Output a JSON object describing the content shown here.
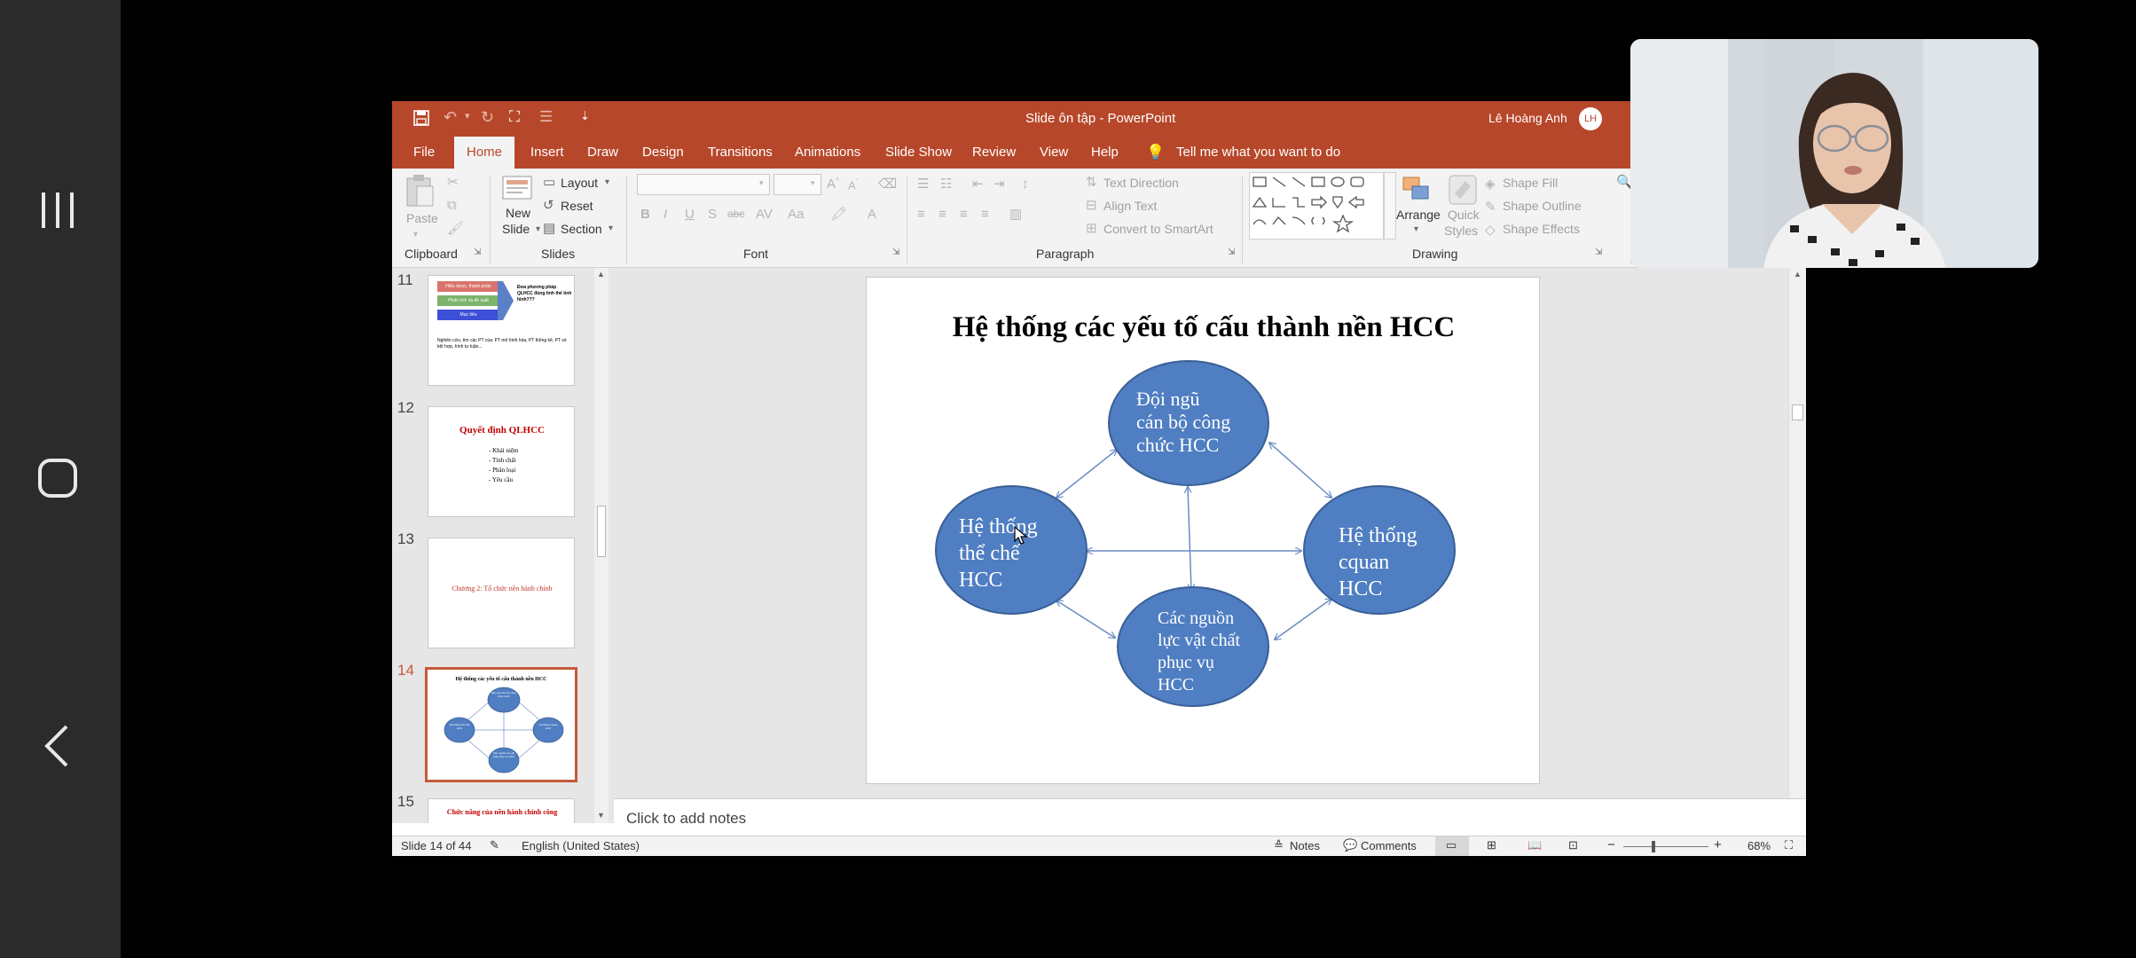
{
  "window": {
    "title": "Slide ôn tập - PowerPoint",
    "user_name": "Lê Hoàng Anh",
    "user_initials": "LH"
  },
  "tabs": [
    "File",
    "Home",
    "Insert",
    "Draw",
    "Design",
    "Transitions",
    "Animations",
    "Slide Show",
    "Review",
    "View",
    "Help"
  ],
  "tell_me": "Tell me what you want to do",
  "ribbon": {
    "clipboard": {
      "label": "Clipboard",
      "paste": "Paste"
    },
    "slides": {
      "label": "Slides",
      "new_slide_1": "New",
      "new_slide_2": "Slide",
      "layout": "Layout",
      "reset": "Reset",
      "section": "Section"
    },
    "font": {
      "label": "Font"
    },
    "paragraph": {
      "label": "Paragraph",
      "text_direction": "Text Direction",
      "align_text": "Align Text",
      "smartart": "Convert to SmartArt"
    },
    "drawing": {
      "label": "Drawing",
      "arrange": "Arrange",
      "quick_styles_1": "Quick",
      "quick_styles_2": "Styles",
      "shape_fill": "Shape Fill",
      "shape_outline": "Shape Outline",
      "shape_effects": "Shape Effects"
    }
  },
  "thumbnails": [
    {
      "num": "11",
      "bar1": "Hiểu được, thành phần",
      "bar2": "Phân tích và đề xuất",
      "bar3": "Mục tiêu",
      "side": "Đưa phương pháp QLHCC đúng tình thế tình hình???",
      "text": "Nghiên cứu, tìm các PT cùa: PT mô hình hóa, PT thống kê, PT só kệt hợp, hình tự luận..."
    },
    {
      "num": "12",
      "title": "Quyết định QLHCC",
      "bullets": [
        "Khái niệm",
        "Tính chất",
        "Phân loại",
        "Yêu cầu"
      ]
    },
    {
      "num": "13",
      "text": "Chương 2: Tổ chức nền hành chính"
    },
    {
      "num": "14",
      "title": "Hệ thống các yếu tố cấu thành nền HCC",
      "n_top": "Đội ngũ cán bộ công chức HCC",
      "n_left": "Hệ thống thể chế HCC",
      "n_right": "Hệ thống cquan HCC",
      "n_bottom": "Các nguồn lực vật chất phục vụ HCC"
    },
    {
      "num": "15",
      "title": "Chức năng của nền hành chính công"
    }
  ],
  "slide": {
    "title": "Hệ thống các yếu tố cấu thành nền HCC",
    "node_top": [
      "Đội ngũ",
      "cán bộ công",
      "chức HCC"
    ],
    "node_left": [
      "Hệ thống",
      "thể chế",
      "HCC"
    ],
    "node_right": [
      "Hệ thống",
      "cquan",
      "HCC"
    ],
    "node_bottom": [
      "Các nguồn",
      "lực vật chất",
      "phục vụ",
      "HCC"
    ]
  },
  "notes_placeholder": "Click to add notes",
  "status": {
    "slide_count": "Slide 14 of 44",
    "language": "English (United States)",
    "notes": "Notes",
    "comments": "Comments",
    "zoom": "68%"
  },
  "colors": {
    "accent": "#b7472a",
    "node_fill": "#4f7ec2",
    "node_stroke": "#3a5f96"
  }
}
